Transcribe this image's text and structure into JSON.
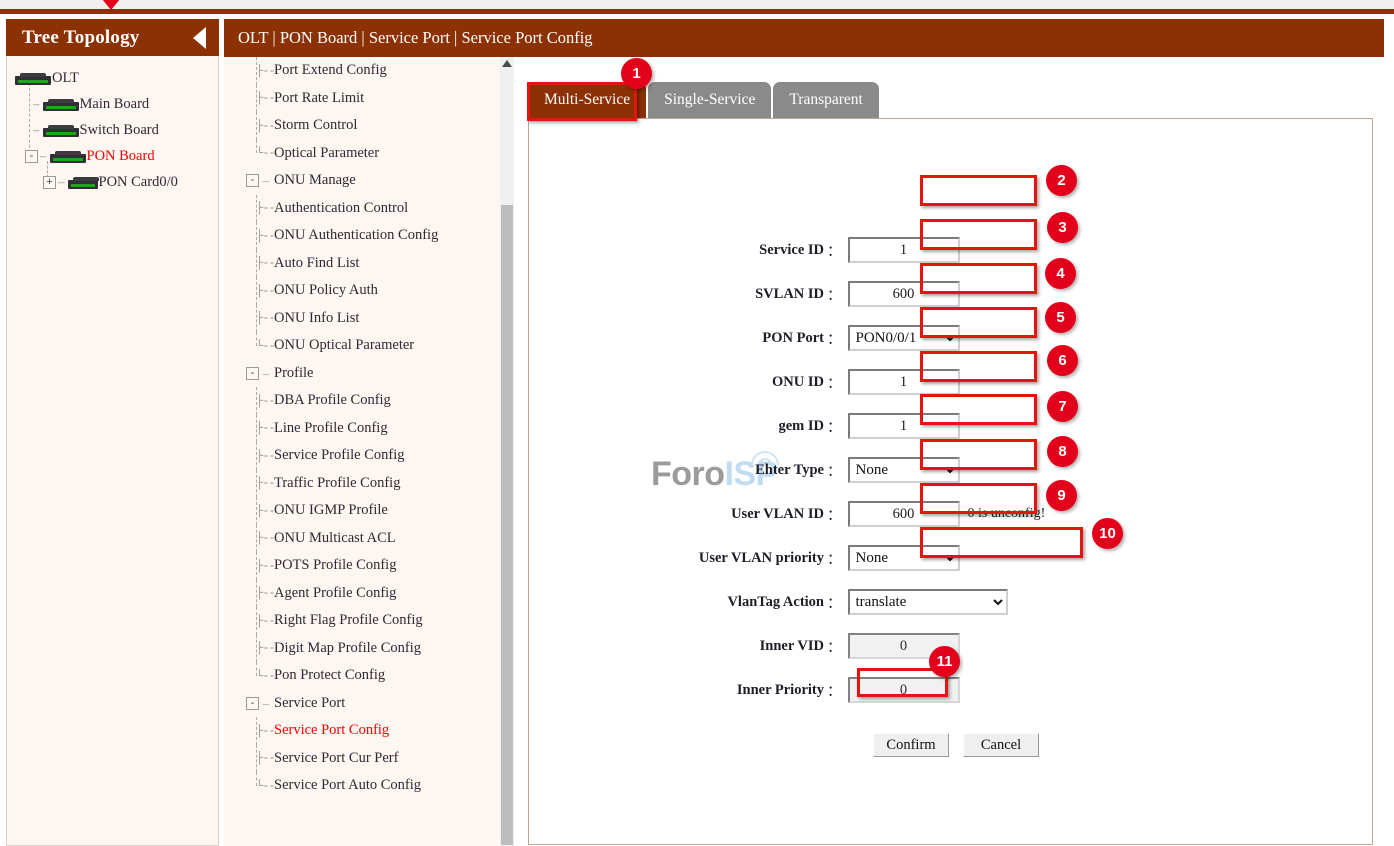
{
  "header": {
    "breadcrumb": "OLT | PON Board | Service Port | Service Port Config",
    "tree_title": "Tree Topology"
  },
  "tree": {
    "nodes": [
      {
        "label": "OLT",
        "kind": "root"
      },
      {
        "label": "Main Board",
        "kind": "child"
      },
      {
        "label": "Switch Board",
        "kind": "child"
      },
      {
        "label": "PON Board",
        "kind": "child-selected",
        "expander": "-"
      },
      {
        "label": "PON Card0/0",
        "kind": "grandchild",
        "expander": "+"
      }
    ]
  },
  "nav": {
    "items": [
      {
        "label": "Port Extend Config",
        "type": "leaf"
      },
      {
        "label": "Port Rate Limit",
        "type": "leaf"
      },
      {
        "label": "Storm Control",
        "type": "leaf"
      },
      {
        "label": "Optical Parameter",
        "type": "leaf",
        "last": true
      },
      {
        "label": "ONU Manage",
        "type": "group",
        "expander": "-"
      },
      {
        "label": "Authentication Control",
        "type": "leaf"
      },
      {
        "label": "ONU Authentication Config",
        "type": "leaf"
      },
      {
        "label": "Auto Find List",
        "type": "leaf"
      },
      {
        "label": "ONU Policy Auth",
        "type": "leaf"
      },
      {
        "label": "ONU Info List",
        "type": "leaf"
      },
      {
        "label": "ONU Optical Parameter",
        "type": "leaf",
        "last": true
      },
      {
        "label": "Profile",
        "type": "group",
        "expander": "-"
      },
      {
        "label": "DBA Profile Config",
        "type": "leaf"
      },
      {
        "label": "Line Profile Config",
        "type": "leaf"
      },
      {
        "label": "Service Profile Config",
        "type": "leaf"
      },
      {
        "label": "Traffic Profile Config",
        "type": "leaf"
      },
      {
        "label": "ONU IGMP Profile",
        "type": "leaf"
      },
      {
        "label": "ONU Multicast ACL",
        "type": "leaf"
      },
      {
        "label": "POTS Profile Config",
        "type": "leaf"
      },
      {
        "label": "Agent Profile Config",
        "type": "leaf"
      },
      {
        "label": "Right Flag Profile Config",
        "type": "leaf"
      },
      {
        "label": "Digit Map Profile Config",
        "type": "leaf"
      },
      {
        "label": "Pon Protect Config",
        "type": "leaf",
        "last": true
      },
      {
        "label": "Service Port",
        "type": "group",
        "expander": "-"
      },
      {
        "label": "Service Port Config",
        "type": "leaf",
        "selected": true
      },
      {
        "label": "Service Port Cur Perf",
        "type": "leaf"
      },
      {
        "label": "Service Port Auto Config",
        "type": "leaf",
        "last": true
      }
    ]
  },
  "tabs": [
    {
      "label": "Multi-Service",
      "active": true
    },
    {
      "label": "Single-Service",
      "active": false
    },
    {
      "label": "Transparent",
      "active": false
    }
  ],
  "form": {
    "fields": [
      {
        "label": "Service ID",
        "value": "1",
        "control": "input"
      },
      {
        "label": "SVLAN ID",
        "value": "600",
        "control": "input"
      },
      {
        "label": "PON Port",
        "value": "PON0/0/1",
        "control": "select"
      },
      {
        "label": "ONU ID",
        "value": "1",
        "control": "input"
      },
      {
        "label": "gem ID",
        "value": "1",
        "control": "input"
      },
      {
        "label": "Ehter Type",
        "value": "None",
        "control": "select"
      },
      {
        "label": "User VLAN ID",
        "value": "600",
        "control": "input",
        "hint": "0 is unconfig!"
      },
      {
        "label": "User VLAN priority",
        "value": "None",
        "control": "select"
      },
      {
        "label": "VlanTag Action",
        "value": "translate",
        "control": "select-wide"
      },
      {
        "label": "Inner VID",
        "value": "0",
        "control": "input-disabled"
      },
      {
        "label": "Inner Priority",
        "value": "0",
        "control": "input-disabled"
      }
    ],
    "colon": "：",
    "confirm_label": "Confirm",
    "cancel_label": "Cancel"
  },
  "watermark": {
    "part1": "Foro",
    "part2": "ISP"
  },
  "badges": [
    "1",
    "2",
    "3",
    "4",
    "5",
    "6",
    "7",
    "8",
    "9",
    "10",
    "11"
  ],
  "colors": {
    "brand": "#8B3103",
    "accent_red": "#e2001a",
    "highlight": "#e8130f",
    "panel_bg": "#fdf6f1"
  }
}
